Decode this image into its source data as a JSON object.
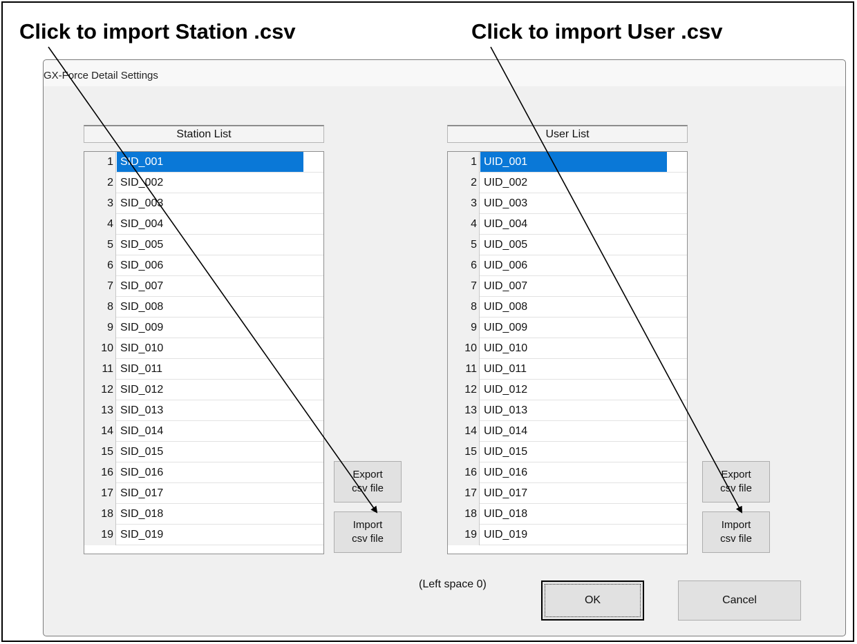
{
  "annotations": {
    "station_label": "Click to import Station .csv",
    "user_label": "Click to import User .csv"
  },
  "window": {
    "title": "GX-Force Detail Settings"
  },
  "station_list": {
    "header": "Station List",
    "selected_index": 1,
    "rows": [
      {
        "num": "1",
        "value": "SID_001"
      },
      {
        "num": "2",
        "value": "SID_002"
      },
      {
        "num": "3",
        "value": "SID_003"
      },
      {
        "num": "4",
        "value": "SID_004"
      },
      {
        "num": "5",
        "value": "SID_005"
      },
      {
        "num": "6",
        "value": "SID_006"
      },
      {
        "num": "7",
        "value": "SID_007"
      },
      {
        "num": "8",
        "value": "SID_008"
      },
      {
        "num": "9",
        "value": "SID_009"
      },
      {
        "num": "10",
        "value": "SID_010"
      },
      {
        "num": "11",
        "value": "SID_011"
      },
      {
        "num": "12",
        "value": "SID_012"
      },
      {
        "num": "13",
        "value": "SID_013"
      },
      {
        "num": "14",
        "value": "SID_014"
      },
      {
        "num": "15",
        "value": "SID_015"
      },
      {
        "num": "16",
        "value": "SID_016"
      },
      {
        "num": "17",
        "value": "SID_017"
      },
      {
        "num": "18",
        "value": "SID_018"
      },
      {
        "num": "19",
        "value": "SID_019"
      }
    ],
    "export_button": [
      "Export",
      "csv file"
    ],
    "import_button": [
      "Import",
      "csv file"
    ]
  },
  "user_list": {
    "header": "User List",
    "selected_index": 1,
    "rows": [
      {
        "num": "1",
        "value": "UID_001"
      },
      {
        "num": "2",
        "value": "UID_002"
      },
      {
        "num": "3",
        "value": "UID_003"
      },
      {
        "num": "4",
        "value": "UID_004"
      },
      {
        "num": "5",
        "value": "UID_005"
      },
      {
        "num": "6",
        "value": "UID_006"
      },
      {
        "num": "7",
        "value": "UID_007"
      },
      {
        "num": "8",
        "value": "UID_008"
      },
      {
        "num": "9",
        "value": "UID_009"
      },
      {
        "num": "10",
        "value": "UID_010"
      },
      {
        "num": "11",
        "value": "UID_011"
      },
      {
        "num": "12",
        "value": "UID_012"
      },
      {
        "num": "13",
        "value": "UID_013"
      },
      {
        "num": "14",
        "value": "UID_014"
      },
      {
        "num": "15",
        "value": "UID_015"
      },
      {
        "num": "16",
        "value": "UID_016"
      },
      {
        "num": "17",
        "value": "UID_017"
      },
      {
        "num": "18",
        "value": "UID_018"
      },
      {
        "num": "19",
        "value": "UID_019"
      }
    ],
    "export_button": [
      "Export",
      "csv file"
    ],
    "import_button": [
      "Import",
      "csv file"
    ]
  },
  "footer": {
    "left_space": "(Left space 0)",
    "ok_label": "OK",
    "cancel_label": "Cancel"
  },
  "colors": {
    "selection": "#0a78d7",
    "dialog_bg": "#f0f0f0"
  }
}
